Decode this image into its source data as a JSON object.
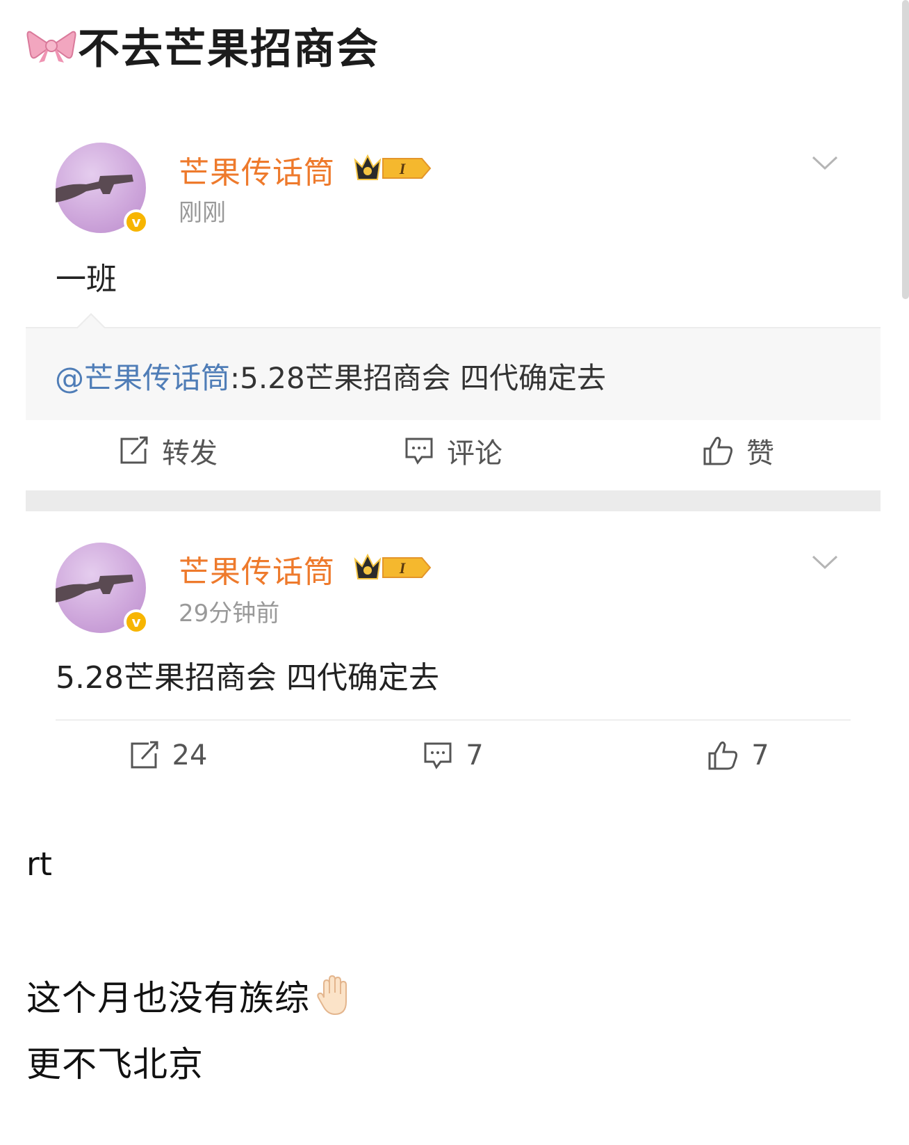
{
  "post": {
    "title": "不去芒果招商会",
    "rt": "rt",
    "body_line_1": "这个月也没有族综",
    "body_line_2": "更不飞北京"
  },
  "repost_card": {
    "author": "芒果传话筒",
    "time": "刚刚",
    "text": "一班",
    "quote_mention": "@芒果传话筒",
    "quote_text": ":5.28芒果招商会 四代确定去",
    "actions": {
      "repost_label": "转发",
      "comment_label": "评论",
      "like_label": "赞"
    }
  },
  "original_card": {
    "author": "芒果传话筒",
    "time": "29分钟前",
    "text": "5.28芒果招商会 四代确定去",
    "counts": {
      "repost": "24",
      "comment": "7",
      "like": "7"
    }
  },
  "badge": {
    "verified_mark": "v",
    "member_level": "I"
  },
  "icons": {
    "title_icon": "pink-bow-icon",
    "raised_hand": "raised-hand-emoji",
    "repost": "repost-icon",
    "comment": "comment-icon",
    "like": "thumbs-up-icon",
    "menu": "chevron-down-icon",
    "crown": "crown-badge-icon"
  },
  "colors": {
    "author_name": "#ee7a2c",
    "mention": "#4f7db7",
    "verified": "#f7b500"
  }
}
